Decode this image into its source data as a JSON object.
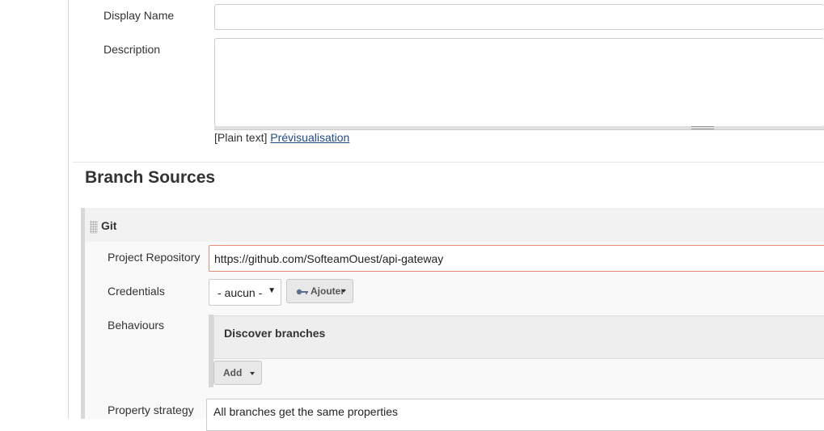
{
  "form": {
    "display_name_label": "Display Name",
    "display_name_value": "",
    "description_label": "Description",
    "description_value": "",
    "description_format_prefix": "[Plain text]",
    "preview_link": "Prévisualisation"
  },
  "branch_sources": {
    "title": "Branch Sources",
    "git": {
      "title": "Git",
      "project_repository_label": "Project Repository",
      "project_repository_value": "https://github.com/SofteamOuest/api-gateway",
      "credentials_label": "Credentials",
      "credentials_selected": "- aucun -",
      "add_credentials_button": "Ajouter",
      "behaviours_label": "Behaviours",
      "behaviours_items": [
        "Discover branches"
      ],
      "behaviours_add_button": "Add",
      "property_strategy_label": "Property strategy",
      "property_strategy_value": "All branches get the same properties"
    }
  },
  "colors": {
    "error_border": "#e78c73",
    "link": "#204a87",
    "key_icon": "#5d6f8c"
  },
  "icons": [
    "drag-handle-icon",
    "key-icon",
    "chevron-down-icon",
    "resize-grip-icon"
  ]
}
